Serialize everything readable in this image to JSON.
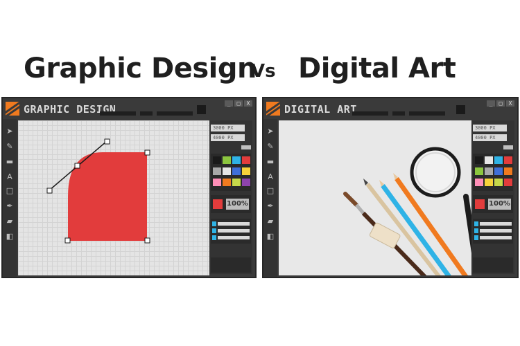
{
  "headline": {
    "left_title": "Graphic Design",
    "vs": "Vs",
    "right_title": "Digital Art"
  },
  "windows": [
    {
      "title": "GRAPHIC DESIGN",
      "buttons": [
        "_",
        "□",
        "X"
      ],
      "width_field": "3000 PX",
      "height_field": "4000 PX",
      "zoom": "100%",
      "tools": [
        "pointer-icon",
        "pencil-icon",
        "rectangle-icon",
        "text-icon",
        "square-icon",
        "pen-icon",
        "eraser-icon",
        "layers-icon"
      ]
    },
    {
      "title": "DIGITAL ART",
      "buttons": [
        "_",
        "□",
        "X"
      ],
      "width_field": "3000 PX",
      "height_field": "4000 PX",
      "zoom": "100%",
      "tools": [
        "pointer-icon",
        "pencil-icon",
        "rectangle-icon",
        "text-icon",
        "square-icon",
        "pen-icon",
        "eraser-icon",
        "layers-icon"
      ]
    }
  ],
  "palette": [
    "#1a1a1a",
    "#8cc63f",
    "#2fb3e6",
    "#e23c3c",
    "#a9a9a9",
    "#e6e6e6",
    "#3f6fd8",
    "#f7d23a",
    "#f07a1f",
    "#ff8fb8",
    "#c6d84a",
    "#3d1a1a",
    "#f7d23a",
    "#e23c3c",
    "#8e44ad"
  ],
  "colors": {
    "accent_orange": "#f07a1f",
    "shape_red": "#e23c3c",
    "layer_blue": "#2fb3e6"
  }
}
